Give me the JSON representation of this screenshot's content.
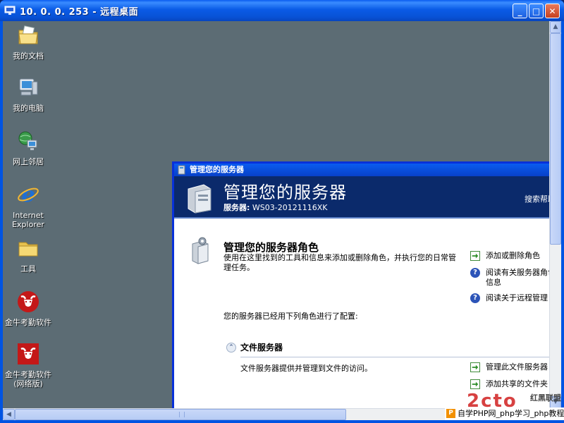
{
  "window": {
    "title": "10. 0. 0. 253 - 远程桌面",
    "minimize_glyph": "_",
    "maximize_glyph": "□",
    "close_glyph": "✕"
  },
  "desktop": {
    "icons": [
      {
        "label": "我的文档",
        "icon": "my-documents-icon"
      },
      {
        "label": "我的电脑",
        "icon": "my-computer-icon"
      },
      {
        "label": "网上邻居",
        "icon": "network-places-icon"
      },
      {
        "label": "Internet Explorer",
        "icon": "internet-explorer-icon"
      },
      {
        "label": "工具",
        "icon": "folder-icon"
      },
      {
        "label": "金牛考勤软件",
        "icon": "bull-app-icon"
      },
      {
        "label": "金牛考勤软件(网络版)",
        "icon": "bull-app-network-icon"
      }
    ]
  },
  "server_manager": {
    "title": "管理您的服务器",
    "heading": "管理您的服务器",
    "server_label": "服务器:",
    "server_name": "WS03-20121116XK",
    "search_help": "搜索帮助",
    "roles_title": "管理您的服务器角色",
    "roles_desc": "使用在这里找到的工具和信息来添加或删除角色，并执行您的日常管理任务。",
    "configured_text": "您的服务器已经用下列角色进行了配置:",
    "actions": [
      {
        "label": "添加或删除角色",
        "icon": "green-arrow-icon"
      },
      {
        "label": "阅读有关服务器角色信息",
        "icon": "help-icon"
      },
      {
        "label": "阅读关于远程管理",
        "icon": "help-icon"
      }
    ],
    "file_server": {
      "collapse_glyph": "⌃",
      "title": "文件服务器",
      "desc": "文件服务器提供并管理到文件的访问。",
      "actions": [
        {
          "label": "管理此文件服务器",
          "icon": "green-arrow-icon"
        },
        {
          "label": "添加共享的文件夹",
          "icon": "green-arrow-icon"
        }
      ]
    }
  },
  "watermarks": {
    "logo_text": "红黑联盟",
    "bar_badge": "P",
    "bar_text": "自学PHP网_php学习_php教程"
  },
  "scrollbars": {
    "up": "▲",
    "down": "▼",
    "left": "◀",
    "right": "▶"
  },
  "colors": {
    "titlebar": "#0a5be6",
    "desktop": "#5c6c74",
    "server_header": "#0b2a6b"
  }
}
